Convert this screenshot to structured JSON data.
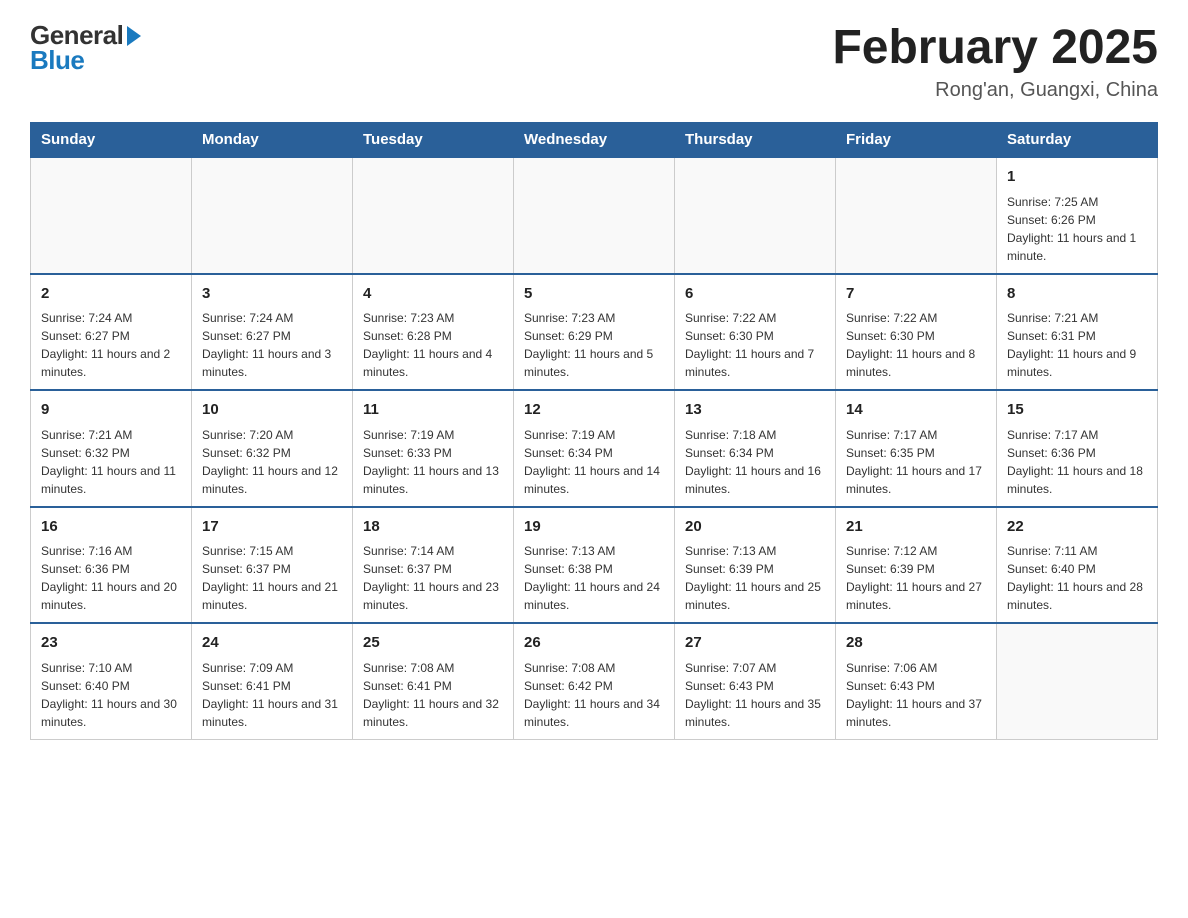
{
  "logo": {
    "general": "General",
    "blue": "Blue"
  },
  "title": "February 2025",
  "subtitle": "Rong'an, Guangxi, China",
  "weekdays": [
    "Sunday",
    "Monday",
    "Tuesday",
    "Wednesday",
    "Thursday",
    "Friday",
    "Saturday"
  ],
  "weeks": [
    [
      {
        "day": "",
        "info": ""
      },
      {
        "day": "",
        "info": ""
      },
      {
        "day": "",
        "info": ""
      },
      {
        "day": "",
        "info": ""
      },
      {
        "day": "",
        "info": ""
      },
      {
        "day": "",
        "info": ""
      },
      {
        "day": "1",
        "info": "Sunrise: 7:25 AM\nSunset: 6:26 PM\nDaylight: 11 hours and 1 minute."
      }
    ],
    [
      {
        "day": "2",
        "info": "Sunrise: 7:24 AM\nSunset: 6:27 PM\nDaylight: 11 hours and 2 minutes."
      },
      {
        "day": "3",
        "info": "Sunrise: 7:24 AM\nSunset: 6:27 PM\nDaylight: 11 hours and 3 minutes."
      },
      {
        "day": "4",
        "info": "Sunrise: 7:23 AM\nSunset: 6:28 PM\nDaylight: 11 hours and 4 minutes."
      },
      {
        "day": "5",
        "info": "Sunrise: 7:23 AM\nSunset: 6:29 PM\nDaylight: 11 hours and 5 minutes."
      },
      {
        "day": "6",
        "info": "Sunrise: 7:22 AM\nSunset: 6:30 PM\nDaylight: 11 hours and 7 minutes."
      },
      {
        "day": "7",
        "info": "Sunrise: 7:22 AM\nSunset: 6:30 PM\nDaylight: 11 hours and 8 minutes."
      },
      {
        "day": "8",
        "info": "Sunrise: 7:21 AM\nSunset: 6:31 PM\nDaylight: 11 hours and 9 minutes."
      }
    ],
    [
      {
        "day": "9",
        "info": "Sunrise: 7:21 AM\nSunset: 6:32 PM\nDaylight: 11 hours and 11 minutes."
      },
      {
        "day": "10",
        "info": "Sunrise: 7:20 AM\nSunset: 6:32 PM\nDaylight: 11 hours and 12 minutes."
      },
      {
        "day": "11",
        "info": "Sunrise: 7:19 AM\nSunset: 6:33 PM\nDaylight: 11 hours and 13 minutes."
      },
      {
        "day": "12",
        "info": "Sunrise: 7:19 AM\nSunset: 6:34 PM\nDaylight: 11 hours and 14 minutes."
      },
      {
        "day": "13",
        "info": "Sunrise: 7:18 AM\nSunset: 6:34 PM\nDaylight: 11 hours and 16 minutes."
      },
      {
        "day": "14",
        "info": "Sunrise: 7:17 AM\nSunset: 6:35 PM\nDaylight: 11 hours and 17 minutes."
      },
      {
        "day": "15",
        "info": "Sunrise: 7:17 AM\nSunset: 6:36 PM\nDaylight: 11 hours and 18 minutes."
      }
    ],
    [
      {
        "day": "16",
        "info": "Sunrise: 7:16 AM\nSunset: 6:36 PM\nDaylight: 11 hours and 20 minutes."
      },
      {
        "day": "17",
        "info": "Sunrise: 7:15 AM\nSunset: 6:37 PM\nDaylight: 11 hours and 21 minutes."
      },
      {
        "day": "18",
        "info": "Sunrise: 7:14 AM\nSunset: 6:37 PM\nDaylight: 11 hours and 23 minutes."
      },
      {
        "day": "19",
        "info": "Sunrise: 7:13 AM\nSunset: 6:38 PM\nDaylight: 11 hours and 24 minutes."
      },
      {
        "day": "20",
        "info": "Sunrise: 7:13 AM\nSunset: 6:39 PM\nDaylight: 11 hours and 25 minutes."
      },
      {
        "day": "21",
        "info": "Sunrise: 7:12 AM\nSunset: 6:39 PM\nDaylight: 11 hours and 27 minutes."
      },
      {
        "day": "22",
        "info": "Sunrise: 7:11 AM\nSunset: 6:40 PM\nDaylight: 11 hours and 28 minutes."
      }
    ],
    [
      {
        "day": "23",
        "info": "Sunrise: 7:10 AM\nSunset: 6:40 PM\nDaylight: 11 hours and 30 minutes."
      },
      {
        "day": "24",
        "info": "Sunrise: 7:09 AM\nSunset: 6:41 PM\nDaylight: 11 hours and 31 minutes."
      },
      {
        "day": "25",
        "info": "Sunrise: 7:08 AM\nSunset: 6:41 PM\nDaylight: 11 hours and 32 minutes."
      },
      {
        "day": "26",
        "info": "Sunrise: 7:08 AM\nSunset: 6:42 PM\nDaylight: 11 hours and 34 minutes."
      },
      {
        "day": "27",
        "info": "Sunrise: 7:07 AM\nSunset: 6:43 PM\nDaylight: 11 hours and 35 minutes."
      },
      {
        "day": "28",
        "info": "Sunrise: 7:06 AM\nSunset: 6:43 PM\nDaylight: 11 hours and 37 minutes."
      },
      {
        "day": "",
        "info": ""
      }
    ]
  ]
}
